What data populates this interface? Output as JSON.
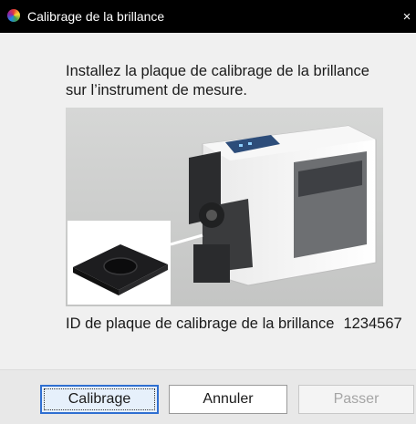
{
  "window": {
    "title": "Calibrage de la brillance",
    "close_glyph": "×",
    "icon": "color-wheel-icon"
  },
  "instruction": {
    "line1": "Installez la plaque de calibrage de la brillance",
    "line2": "sur l’instrument de mesure."
  },
  "plate": {
    "label": "ID de plaque de calibrage de la brillance",
    "id": "1234567"
  },
  "buttons": {
    "calibrate": "Calibrage",
    "cancel": "Annuler",
    "skip": "Passer",
    "skip_enabled": false
  },
  "colors": {
    "titlebar": "#000000",
    "primary_border": "#2f6fd1",
    "disabled_text": "#a5a5a5"
  }
}
